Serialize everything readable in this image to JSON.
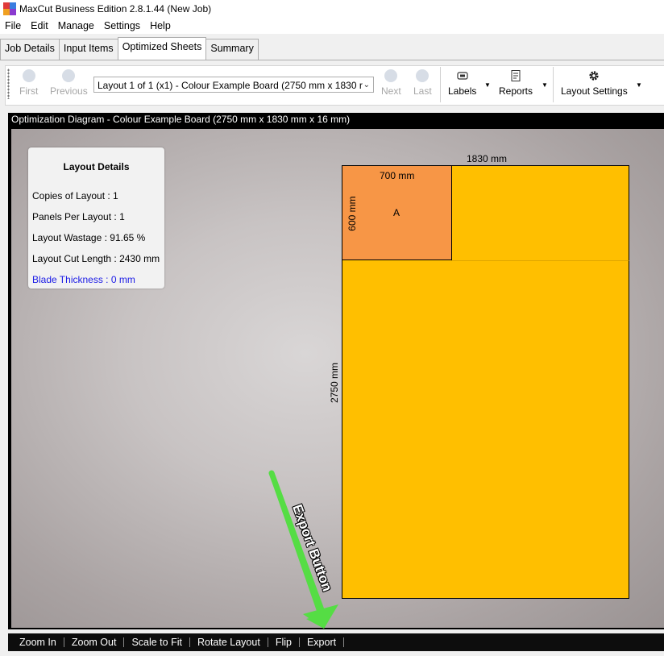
{
  "window": {
    "title": "MaxCut Business Edition 2.8.1.44 (New Job)"
  },
  "menu": [
    "File",
    "Edit",
    "Manage",
    "Settings",
    "Help"
  ],
  "tabs": [
    "Job Details",
    "Input Items",
    "Optimized Sheets",
    "Summary"
  ],
  "active_tab": "Optimized Sheets",
  "toolbar": {
    "first": "First",
    "previous": "Previous",
    "layout_select": "Layout 1 of 1 (x1) - Colour Example Board (2750 mm x 1830 r",
    "next": "Next",
    "last": "Last",
    "labels": "Labels",
    "reports": "Reports",
    "layout_settings": "Layout Settings"
  },
  "diagram": {
    "header": "Optimization Diagram - Colour Example Board (2750 mm x 1830 mm x 16 mm)",
    "board_width_label": "1830 mm",
    "board_length_label": "2750 mm",
    "panel_width_label": "700 mm",
    "panel_length_label": "600 mm",
    "panel_id": "A"
  },
  "layout_details": {
    "title": "Layout Details",
    "copies": "Copies of Layout :  1",
    "panels": "Panels Per Layout :  1",
    "wastage": "Layout Wastage :  91.65 %",
    "cut_length": "Layout Cut Length :  2430 mm",
    "blade": "Blade Thickness :  0 mm"
  },
  "bottom_bar": [
    "Zoom In",
    "Zoom Out",
    "Scale to Fit",
    "Rotate Layout",
    "Flip",
    "Export"
  ],
  "annotation": {
    "text": "Export Button"
  },
  "colors": {
    "board": "#ffbf00",
    "panel": "#f79646",
    "annotation_arrow": "#55dd44",
    "blade_text": "#1a1ae6"
  }
}
